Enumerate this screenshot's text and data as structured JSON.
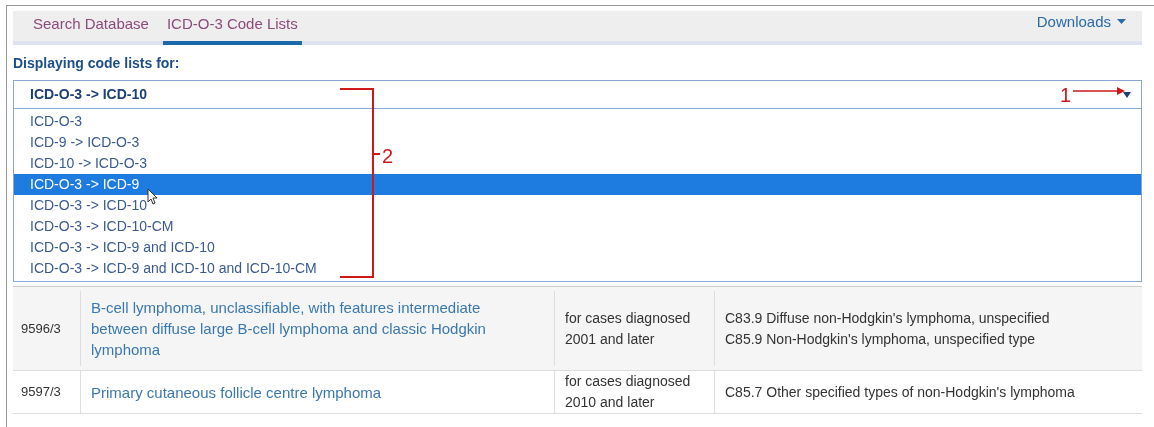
{
  "tabs": [
    {
      "label": "Search Database",
      "selected": false
    },
    {
      "label": "ICD-O-3 Code Lists",
      "selected": true
    }
  ],
  "downloads_menu": {
    "label": "Downloads"
  },
  "code_list_select": {
    "label": "Displaying code lists for:",
    "value": "ICD-O-3 -> ICD-10",
    "expanded": true,
    "options": [
      {
        "label": "ICD-O-3",
        "highlighted": false
      },
      {
        "label": "ICD-9 -> ICD-O-3",
        "highlighted": false
      },
      {
        "label": "ICD-10 -> ICD-O-3",
        "highlighted": false
      },
      {
        "label": "ICD-O-3 -> ICD-9",
        "highlighted": true
      },
      {
        "label": "ICD-O-3 -> ICD-10",
        "highlighted": false
      },
      {
        "label": "ICD-O-3 -> ICD-10-CM",
        "highlighted": false
      },
      {
        "label": "ICD-O-3 -> ICD-9 and ICD-10",
        "highlighted": false
      },
      {
        "label": "ICD-O-3 -> ICD-9 and ICD-10 and ICD-10-CM",
        "highlighted": false
      }
    ]
  },
  "annotations": [
    {
      "label": "1"
    },
    {
      "label": "2"
    }
  ],
  "table": {
    "rows": [
      {
        "code": "9596/3",
        "name": "B-cell lymphoma, unclassifiable, with features intermediate between diffuse large B-cell lymphoma and classic Hodgkin lymphoma",
        "applies": "for cases diagnosed 2001 and later",
        "icd10": [
          "C83.9 Diffuse non-Hodgkin's lymphoma, unspecified",
          "C85.9 Non-Hodgkin's lymphoma, unspecified type"
        ]
      },
      {
        "code": "9597/3",
        "name": "Primary cutaneous follicle centre lymphoma",
        "applies": "for cases diagnosed 2010 and later",
        "icd10": [
          "C85.7 Other specified types of non-Hodgkin's lymphoma"
        ]
      }
    ]
  }
}
